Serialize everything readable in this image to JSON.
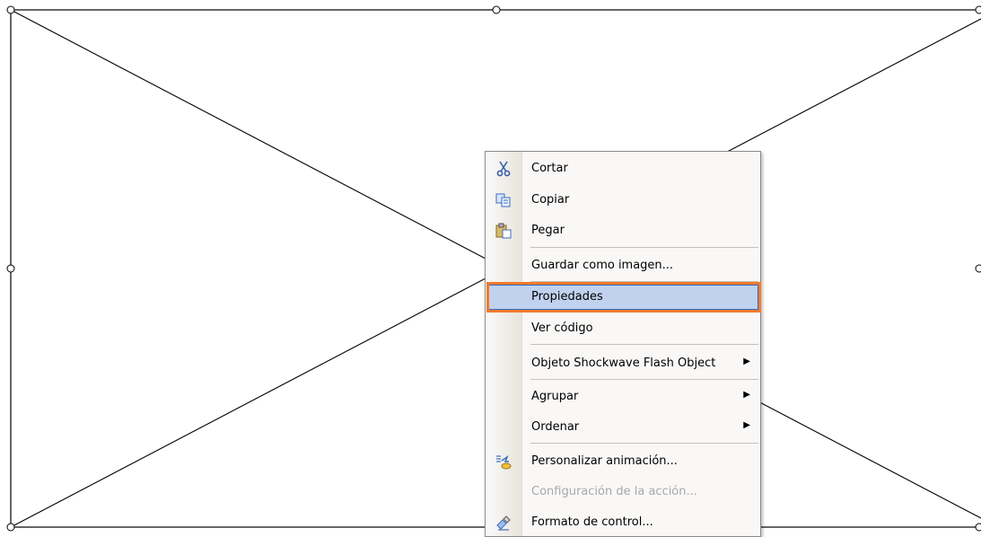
{
  "menu": {
    "items": [
      {
        "label": "Cortar",
        "icon": "scissors-icon"
      },
      {
        "label": "Copiar",
        "icon": "copy-icon"
      },
      {
        "label": "Pegar",
        "icon": "paste-icon"
      },
      {
        "label": "Guardar como imagen..."
      },
      {
        "label": "Propiedades",
        "highlighted": true
      },
      {
        "label": "Ver código"
      },
      {
        "label": "Objeto Shockwave Flash Object",
        "submenu": true
      },
      {
        "label": "Agrupar",
        "submenu": true
      },
      {
        "label": "Ordenar",
        "submenu": true
      },
      {
        "label": "Personalizar animación...",
        "icon": "custom-animation-icon"
      },
      {
        "label": "Configuración de la acción...",
        "disabled": true
      },
      {
        "label": "Formato de control...",
        "icon": "format-control-icon"
      }
    ],
    "submenu_arrow": "▶"
  },
  "colors": {
    "highlight_fill": "#c1d2ee",
    "highlight_border": "#316ac5",
    "callout_border": "#f47a2c",
    "disabled_text": "#a8a8a8"
  }
}
